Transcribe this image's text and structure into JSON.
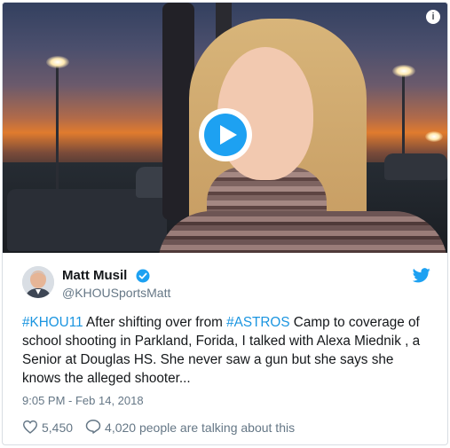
{
  "video": {
    "info_icon_label": "i",
    "play_icon": "play-icon"
  },
  "author": {
    "name": "Matt Musil",
    "handle": "@KHOUSportsMatt",
    "verified": true
  },
  "tweet": {
    "hashtag1": "#KHOU11",
    "text1": " After shifting over from ",
    "hashtag2": "#ASTROS",
    "text2": " Camp to coverage of school shooting in Parkland, Forida, I talked with Alexa Miednik , a Senior at Douglas HS. She never saw a gun but she says she knows the alleged shooter...",
    "timestamp": "9:05 PM - Feb 14, 2018"
  },
  "engagement": {
    "likes": "5,450",
    "talking": "4,020 people are talking about this"
  },
  "colors": {
    "accent": "#1da1f2",
    "link": "#1b95e0",
    "muted": "#657786"
  }
}
